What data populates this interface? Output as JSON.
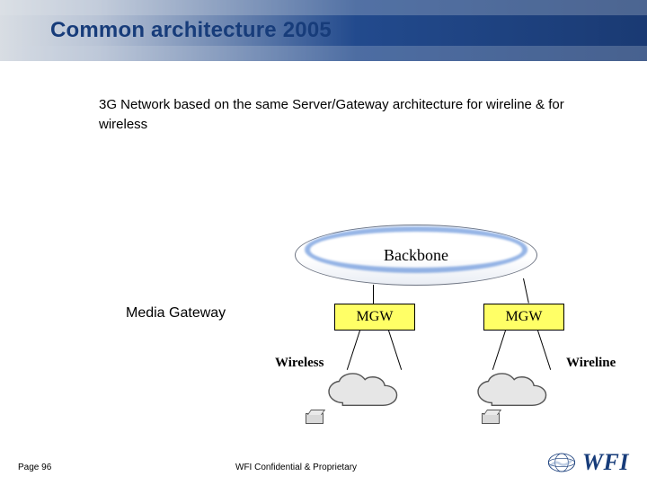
{
  "title": "Common architecture 2005",
  "description": "3G Network based on the same Server/Gateway architecture for wireline & for wireless",
  "diagram": {
    "backbone": "Backbone",
    "media_gateway_label": "Media Gateway",
    "mgw1": "MGW",
    "mgw2": "MGW",
    "cloud1_label": "Wireless",
    "cloud2_label": "Wireline"
  },
  "footer": {
    "page": "Page 96",
    "confidential": "WFI Confidential & Proprietary",
    "logo_text": "WFI"
  }
}
